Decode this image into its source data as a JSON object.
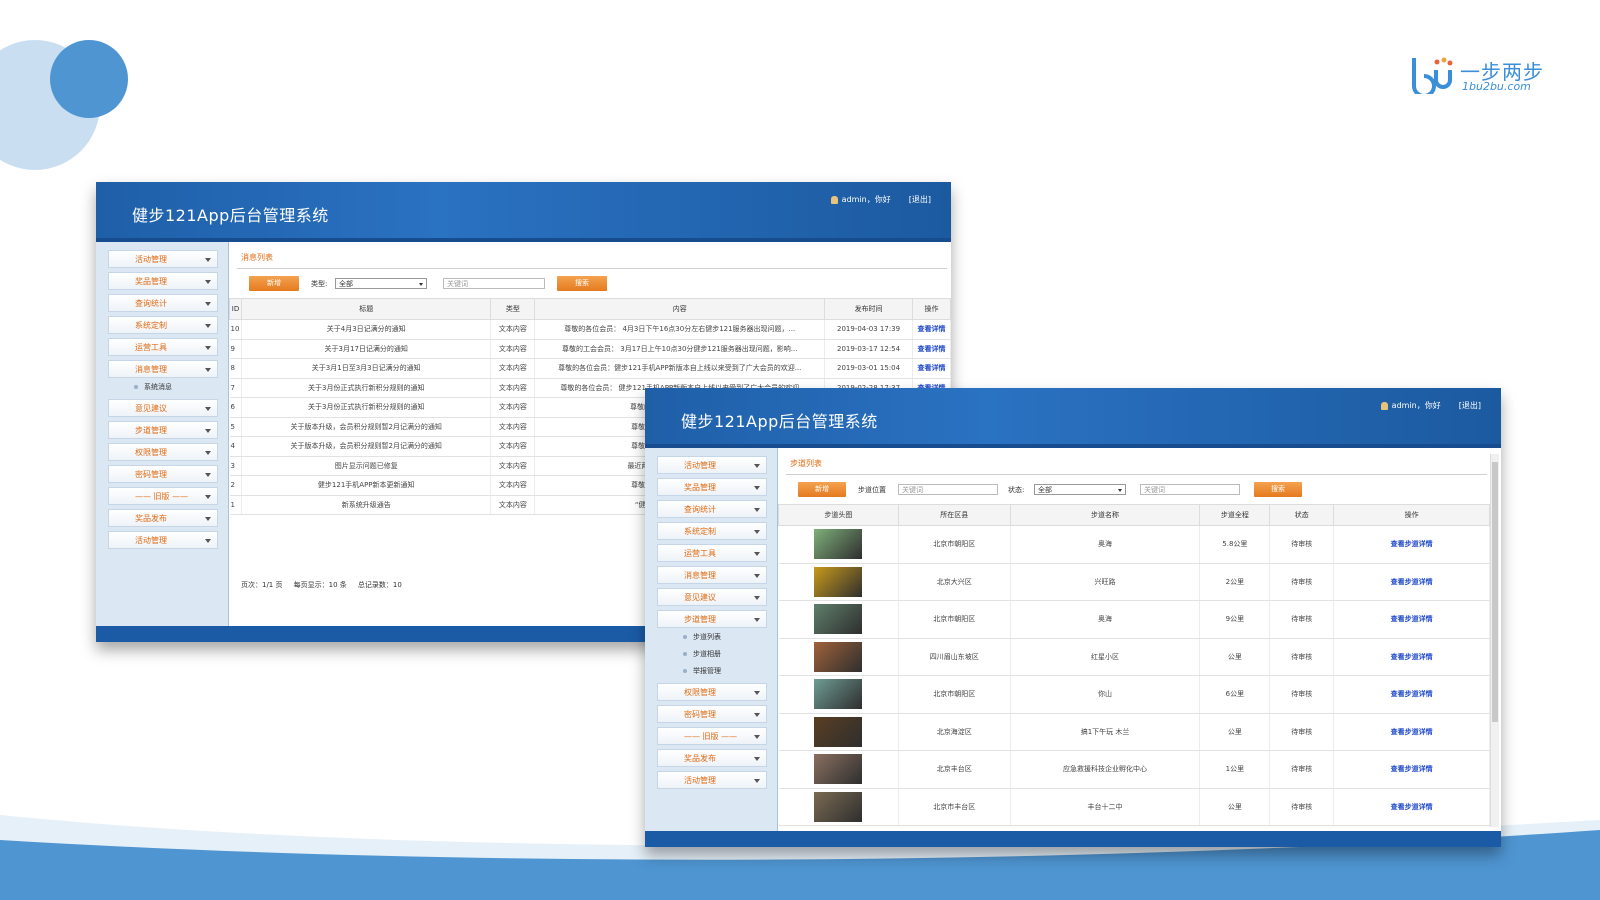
{
  "brand": {
    "name": "一步两步",
    "url": "1bu2bu.com",
    "mark": "bu",
    "color": "#3a8fd8"
  },
  "colors": {
    "header": "#1f5fa8",
    "accent_orange": "#e06a12",
    "link_blue": "#1f49c9",
    "sidebar_bg": "#dbe7f3"
  },
  "window1": {
    "app_title": "健步121App后台管理系统",
    "user": "admin，你好",
    "logout": "[退出]",
    "menu": [
      {
        "label": "活动管理"
      },
      {
        "label": "奖品管理"
      },
      {
        "label": "查询统计"
      },
      {
        "label": "系统定制"
      },
      {
        "label": "运营工具"
      },
      {
        "label": "消息管理"
      }
    ],
    "submenu": [
      {
        "label": "系统消息"
      }
    ],
    "menu_after": [
      {
        "label": "意见建议"
      },
      {
        "label": "步道管理"
      },
      {
        "label": "权限管理"
      },
      {
        "label": "密码管理"
      },
      {
        "label": "—— 旧版 ——"
      },
      {
        "label": "奖品发布"
      },
      {
        "label": "活动管理"
      }
    ],
    "section_title": "消息列表",
    "toolbar": {
      "add": "新增",
      "type_label": "类型:",
      "type_value": "全部",
      "keyword_placeholder": "关键词",
      "search": "搜索"
    },
    "columns": [
      "ID",
      "标题",
      "类型",
      "内容",
      "发布时间",
      "操作"
    ],
    "rows": [
      {
        "id": "10",
        "title": "关于4月3日记满分的通知",
        "type": "文本内容",
        "content": "尊敬的各位会员：  4月3日下午16点30分左右健步121服务器出现问题，...",
        "time": "2019-04-03 17:39",
        "action": "查看详情"
      },
      {
        "id": "9",
        "title": "关于3月17日记满分的通知",
        "type": "文本内容",
        "content": "尊敬的工会会员：  3月17日上午10点30分健步121服务器出现问题，影响...",
        "time": "2019-03-17 12:54",
        "action": "查看详情"
      },
      {
        "id": "8",
        "title": "关于3月1日至3月3日记满分的通知",
        "type": "文本内容",
        "content": "尊敬的各位会员：健步121手机APP新版本自上线以来受到了广大会员的欢迎...",
        "time": "2019-03-01 15:04",
        "action": "查看详情"
      },
      {
        "id": "7",
        "title": "关于3月份正式执行新积分规则的通知",
        "type": "文本内容",
        "content": "尊敬的各位会员：  健步121手机APP新版本自上线以来受到了广大会员的欢迎",
        "time": "2019-02-28 17:37",
        "action": "查看详情"
      },
      {
        "id": "6",
        "title": "关于3月份正式执行新积分规则的通知",
        "type": "文本内容",
        "content": "尊敬的各位会员：  健步121手机",
        "time": "",
        "action": ""
      },
      {
        "id": "5",
        "title": "关于版本升级，会员积分规则暂2月记满分的通知",
        "type": "文本内容",
        "content": "尊敬的各位会员：健步121手机",
        "time": "",
        "action": ""
      },
      {
        "id": "4",
        "title": "关于版本升级，会员积分规则暂2月记满分的通知",
        "type": "文本内容",
        "content": "尊敬的各位会员：健步121手机",
        "time": "",
        "action": ""
      },
      {
        "id": "3",
        "title": "图片显示问题已修复",
        "type": "文本内容",
        "content": "最近两天“健步121”后台系统的图",
        "time": "",
        "action": ""
      },
      {
        "id": "2",
        "title": "健步121手机APP新本更新通知",
        "type": "文本内容",
        "content": "尊敬的各位会员：健步121手机",
        "time": "",
        "action": ""
      },
      {
        "id": "1",
        "title": "新系统升级通告",
        "type": "文本内容",
        "content": "“健步121”手机APP新软件于",
        "time": "",
        "action": ""
      }
    ],
    "pager": {
      "pages": "页次：1/1  页",
      "per_page": "每页显示：10  条",
      "total": "总记录数：10"
    }
  },
  "window2": {
    "app_title": "健步121App后台管理系统",
    "user": "admin，你好",
    "logout": "[退出]",
    "menu": [
      {
        "label": "活动管理"
      },
      {
        "label": "奖品管理"
      },
      {
        "label": "查询统计"
      },
      {
        "label": "系统定制"
      },
      {
        "label": "运营工具"
      },
      {
        "label": "消息管理"
      },
      {
        "label": "意见建议"
      },
      {
        "label": "步道管理"
      }
    ],
    "submenu": [
      {
        "label": "步道列表"
      },
      {
        "label": "步道相册"
      },
      {
        "label": "举报管理"
      }
    ],
    "menu_after": [
      {
        "label": "权限管理"
      },
      {
        "label": "密码管理"
      },
      {
        "label": "—— 旧版 ——"
      },
      {
        "label": "奖品发布"
      },
      {
        "label": "活动管理"
      }
    ],
    "section_title": "步道列表",
    "toolbar": {
      "add": "新增",
      "location_label": "步道位置",
      "location_placeholder": "关键词",
      "status_label": "状态:",
      "status_value": "全部",
      "keyword_placeholder": "关键词",
      "search": "搜索"
    },
    "columns": [
      "步道头图",
      "所在区县",
      "步道名称",
      "步道全程",
      "状态",
      "操作"
    ],
    "rows": [
      {
        "image": "map-route-thumbnail",
        "district": "北京市朝阳区",
        "name": "奥海",
        "length": "5.8公里",
        "status": "待审核",
        "action": "查看步道详情",
        "thumb_color": "#7fb07a"
      },
      {
        "image": "flower-thumbnail",
        "district": "北京大兴区",
        "name": "兴旺路",
        "length": "2公里",
        "status": "待审核",
        "action": "查看步道详情",
        "thumb_color": "#c99a1a"
      },
      {
        "image": "aerial-thumbnail",
        "district": "北京市朝阳区",
        "name": "奥海",
        "length": "9公里",
        "status": "待审核",
        "action": "查看步道详情",
        "thumb_color": "#5e7f6a"
      },
      {
        "image": "autumn-thumbnail",
        "district": "四川眉山东坡区",
        "name": "红星小区",
        "length": "公里",
        "status": "待审核",
        "action": "查看步道详情",
        "thumb_color": "#a0623a"
      },
      {
        "image": "park-map-thumbnail",
        "district": "北京市朝阳区",
        "name": "你山",
        "length": "6公里",
        "status": "待审核",
        "action": "查看步道详情",
        "thumb_color": "#6f9c94"
      },
      {
        "image": "night-thumbnail",
        "district": "北京海淀区",
        "name": "搞1下午玩 木兰",
        "length": "公里",
        "status": "待审核",
        "action": "查看步道详情",
        "thumb_color": "#5a3e22"
      },
      {
        "image": "track-thumbnail",
        "district": "北京丰台区",
        "name": "应急救援科技企业孵化中心",
        "length": "1公里",
        "status": "待审核",
        "action": "查看步道详情",
        "thumb_color": "#8a7060"
      },
      {
        "image": "trees-thumbnail",
        "district": "北京市丰台区",
        "name": "丰台十二中",
        "length": "公里",
        "status": "待审核",
        "action": "查看步道详情",
        "thumb_color": "#7a6a52"
      }
    ]
  }
}
